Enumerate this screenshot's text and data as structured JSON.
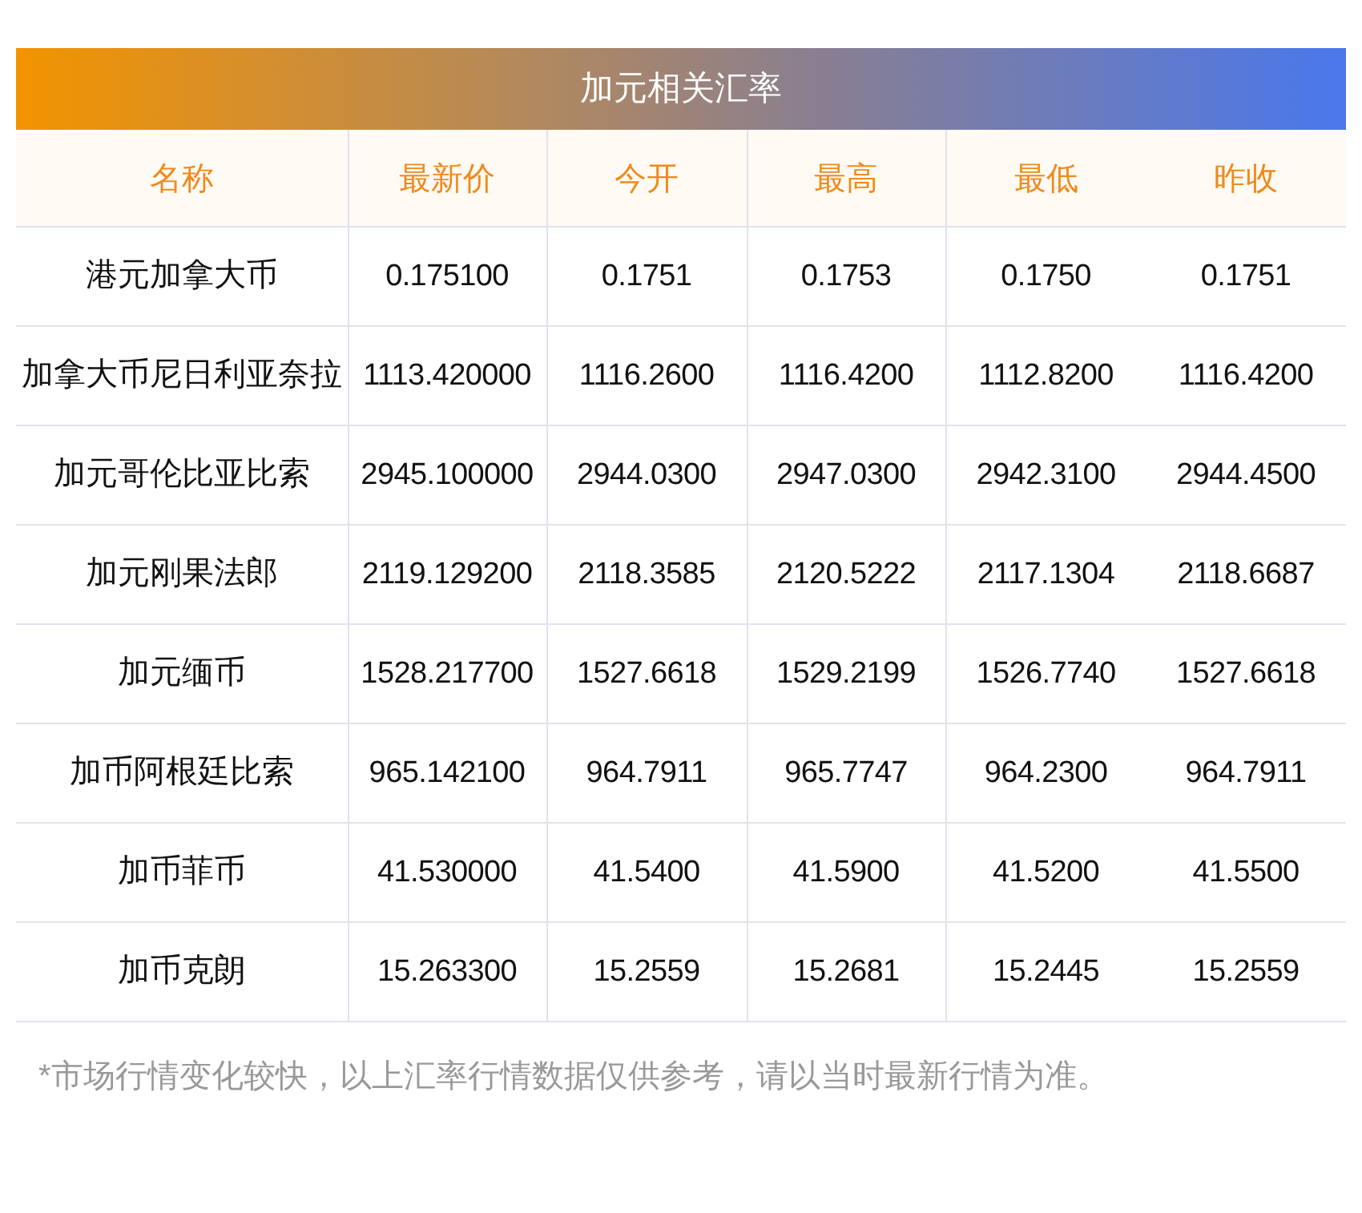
{
  "title": "加元相关汇率",
  "columns": [
    "名称",
    "最新价",
    "今开",
    "最高",
    "最低",
    "昨收"
  ],
  "rows": [
    [
      "港元加拿大币",
      "0.175100",
      "0.1751",
      "0.1753",
      "0.1750",
      "0.1751"
    ],
    [
      "加拿大币尼日利亚奈拉",
      "1113.420000",
      "1116.2600",
      "1116.4200",
      "1112.8200",
      "1116.4200"
    ],
    [
      "加元哥伦比亚比索",
      "2945.100000",
      "2944.0300",
      "2947.0300",
      "2942.3100",
      "2944.4500"
    ],
    [
      "加元刚果法郎",
      "2119.129200",
      "2118.3585",
      "2120.5222",
      "2117.1304",
      "2118.6687"
    ],
    [
      "加元缅币",
      "1528.217700",
      "1527.6618",
      "1529.2199",
      "1526.7740",
      "1527.6618"
    ],
    [
      "加币阿根廷比索",
      "965.142100",
      "964.7911",
      "965.7747",
      "964.2300",
      "964.7911"
    ],
    [
      "加币菲币",
      "41.530000",
      "41.5400",
      "41.5900",
      "41.5200",
      "41.5500"
    ],
    [
      "加币克朗",
      "15.263300",
      "15.2559",
      "15.2681",
      "15.2445",
      "15.2559"
    ]
  ],
  "note": "*市场行情变化较快，以上汇率行情数据仅供参考，请以当时最新行情为准。"
}
